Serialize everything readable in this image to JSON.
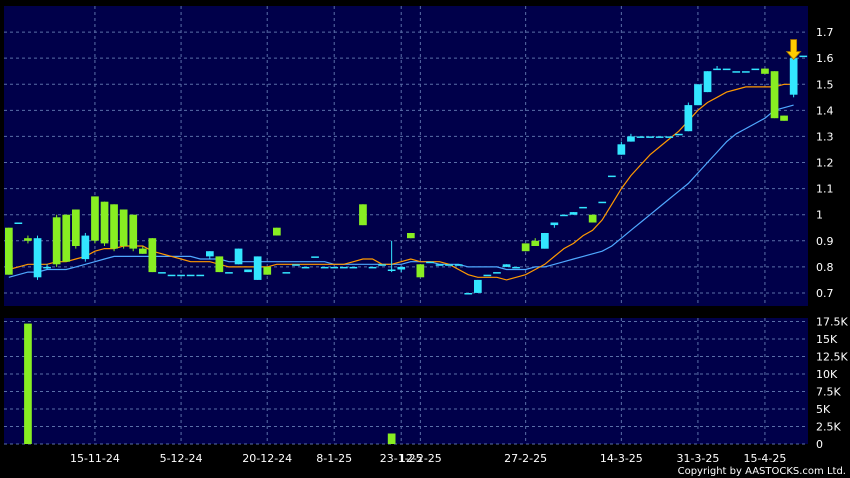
{
  "copyright": "Copyright by AASTOCKS.com Ltd.",
  "colors": {
    "background": "#000000",
    "panel": "#00004a",
    "grid": "#5a6fa8",
    "up_candle": "#33e6ff",
    "down_candle": "#88ee22",
    "ma_short": "#ff9900",
    "ma_long": "#4fa8ff",
    "volume": "#88ee22",
    "signal_arrow": "#ffcc00"
  },
  "chart_data": [
    {
      "type": "candlestick",
      "title": "",
      "ylim": [
        0.65,
        1.8
      ],
      "y_ticks": [
        "0.7",
        "0.8",
        "0.9",
        "1",
        "1.1",
        "1.2",
        "1.3",
        "1.4",
        "1.5",
        "1.6",
        "1.7"
      ],
      "x_tick_labels": [
        "15-11-24",
        "5-12-24",
        "20-12-24",
        "8-1-25",
        "23-1-25",
        "12-2-25",
        "27-2-25",
        "14-3-25",
        "31-3-25",
        "15-4-25"
      ],
      "x_tick_index": [
        9,
        18,
        27,
        34,
        41,
        43,
        54,
        64,
        72,
        79
      ],
      "candles": [
        [
          0.95,
          0.95,
          0.77,
          0.77
        ],
        [
          0.97,
          0.97,
          0.97,
          0.97
        ],
        [
          0.91,
          0.92,
          0.89,
          0.9
        ],
        [
          0.76,
          0.92,
          0.75,
          0.91
        ],
        [
          0.8,
          0.81,
          0.79,
          0.8
        ],
        [
          0.99,
          1.0,
          0.8,
          0.81
        ],
        [
          1.0,
          1.0,
          0.82,
          0.82
        ],
        [
          1.02,
          1.02,
          0.87,
          0.88
        ],
        [
          0.83,
          0.93,
          0.82,
          0.92
        ],
        [
          1.07,
          1.07,
          0.89,
          0.9
        ],
        [
          1.05,
          1.05,
          0.88,
          0.89
        ],
        [
          1.04,
          1.04,
          0.86,
          0.87
        ],
        [
          1.02,
          1.02,
          0.87,
          0.88
        ],
        [
          1.0,
          1.0,
          0.86,
          0.87
        ],
        [
          0.87,
          0.88,
          0.85,
          0.85
        ],
        [
          0.91,
          0.91,
          0.78,
          0.78
        ],
        [
          0.78,
          0.78,
          0.78,
          0.78
        ],
        [
          0.77,
          0.77,
          0.77,
          0.77
        ],
        [
          0.77,
          0.77,
          0.77,
          0.77
        ],
        [
          0.77,
          0.77,
          0.77,
          0.77
        ],
        [
          0.77,
          0.77,
          0.77,
          0.77
        ],
        [
          0.84,
          0.86,
          0.83,
          0.86
        ],
        [
          0.84,
          0.84,
          0.78,
          0.78
        ],
        [
          0.78,
          0.78,
          0.78,
          0.78
        ],
        [
          0.81,
          0.87,
          0.81,
          0.87
        ],
        [
          0.78,
          0.79,
          0.78,
          0.79
        ],
        [
          0.75,
          0.84,
          0.75,
          0.84
        ],
        [
          0.8,
          0.8,
          0.77,
          0.77
        ],
        [
          0.95,
          0.95,
          0.92,
          0.92
        ],
        [
          0.78,
          0.78,
          0.78,
          0.78
        ],
        [
          0.81,
          0.81,
          0.81,
          0.81
        ],
        [
          0.8,
          0.8,
          0.8,
          0.8
        ],
        [
          0.84,
          0.84,
          0.84,
          0.84
        ],
        [
          0.8,
          0.8,
          0.8,
          0.8
        ],
        [
          0.8,
          0.8,
          0.8,
          0.8
        ],
        [
          0.8,
          0.8,
          0.8,
          0.8
        ],
        [
          0.8,
          0.8,
          0.8,
          0.8
        ],
        [
          1.04,
          1.04,
          0.96,
          0.96
        ],
        [
          0.8,
          0.8,
          0.8,
          0.8
        ],
        [
          0.81,
          0.81,
          0.81,
          0.81
        ],
        [
          0.79,
          0.9,
          0.78,
          0.79
        ],
        [
          0.79,
          0.8,
          0.78,
          0.8
        ],
        [
          0.93,
          0.93,
          0.91,
          0.91
        ],
        [
          0.81,
          0.81,
          0.76,
          0.76
        ],
        [
          0.82,
          0.82,
          0.82,
          0.82
        ],
        [
          0.81,
          0.81,
          0.81,
          0.81
        ],
        [
          0.81,
          0.81,
          0.81,
          0.81
        ],
        [
          0.81,
          0.81,
          0.81,
          0.81
        ],
        [
          0.7,
          0.7,
          0.7,
          0.7
        ],
        [
          0.7,
          0.75,
          0.7,
          0.75
        ],
        [
          0.77,
          0.77,
          0.77,
          0.77
        ],
        [
          0.78,
          0.78,
          0.78,
          0.78
        ],
        [
          0.8,
          0.81,
          0.8,
          0.81
        ],
        [
          0.8,
          0.8,
          0.8,
          0.8
        ],
        [
          0.89,
          0.89,
          0.86,
          0.86
        ],
        [
          0.9,
          0.91,
          0.88,
          0.88
        ],
        [
          0.87,
          0.93,
          0.87,
          0.93
        ],
        [
          0.96,
          0.97,
          0.95,
          0.97
        ],
        [
          1.0,
          1.0,
          1.0,
          1.0
        ],
        [
          1.0,
          1.01,
          1.0,
          1.01
        ],
        [
          1.03,
          1.03,
          1.03,
          1.03
        ],
        [
          1.0,
          1.0,
          0.97,
          0.97
        ],
        [
          1.05,
          1.05,
          1.05,
          1.05
        ],
        [
          1.15,
          1.15,
          1.15,
          1.15
        ],
        [
          1.23,
          1.28,
          1.23,
          1.27
        ],
        [
          1.28,
          1.31,
          1.28,
          1.3
        ],
        [
          1.3,
          1.3,
          1.3,
          1.3
        ],
        [
          1.3,
          1.3,
          1.3,
          1.3
        ],
        [
          1.3,
          1.3,
          1.3,
          1.3
        ],
        [
          1.3,
          1.3,
          1.3,
          1.3
        ],
        [
          1.31,
          1.31,
          1.31,
          1.31
        ],
        [
          1.32,
          1.43,
          1.32,
          1.42
        ],
        [
          1.42,
          1.5,
          1.42,
          1.5
        ],
        [
          1.47,
          1.55,
          1.47,
          1.55
        ],
        [
          1.56,
          1.57,
          1.56,
          1.56
        ],
        [
          1.56,
          1.56,
          1.56,
          1.56
        ],
        [
          1.55,
          1.55,
          1.55,
          1.55
        ],
        [
          1.55,
          1.55,
          1.55,
          1.55
        ],
        [
          1.56,
          1.56,
          1.56,
          1.56
        ],
        [
          1.56,
          1.56,
          1.54,
          1.54
        ],
        [
          1.55,
          1.55,
          1.37,
          1.37
        ],
        [
          1.38,
          1.38,
          1.36,
          1.36
        ],
        [
          1.46,
          1.61,
          1.45,
          1.6
        ],
        [
          1.61,
          1.61,
          1.61,
          1.61
        ]
      ],
      "ma_short": [
        0.79,
        0.8,
        0.81,
        0.81,
        0.81,
        0.82,
        0.82,
        0.83,
        0.84,
        0.86,
        0.87,
        0.87,
        0.88,
        0.88,
        0.88,
        0.86,
        0.85,
        0.84,
        0.83,
        0.82,
        0.82,
        0.82,
        0.81,
        0.8,
        0.8,
        0.8,
        0.8,
        0.8,
        0.81,
        0.81,
        0.81,
        0.81,
        0.81,
        0.81,
        0.81,
        0.81,
        0.82,
        0.83,
        0.83,
        0.81,
        0.81,
        0.82,
        0.83,
        0.82,
        0.82,
        0.82,
        0.81,
        0.79,
        0.77,
        0.76,
        0.76,
        0.76,
        0.75,
        0.76,
        0.77,
        0.79,
        0.81,
        0.84,
        0.87,
        0.89,
        0.92,
        0.94,
        0.98,
        1.04,
        1.1,
        1.15,
        1.19,
        1.23,
        1.26,
        1.29,
        1.32,
        1.36,
        1.4,
        1.43,
        1.45,
        1.47,
        1.48,
        1.49,
        1.49,
        1.49,
        1.49,
        1.5,
        1.5
      ],
      "ma_long": [
        0.76,
        0.77,
        0.78,
        0.78,
        0.79,
        0.79,
        0.79,
        0.8,
        0.81,
        0.82,
        0.83,
        0.84,
        0.84,
        0.84,
        0.84,
        0.84,
        0.84,
        0.84,
        0.84,
        0.84,
        0.83,
        0.83,
        0.83,
        0.82,
        0.82,
        0.82,
        0.82,
        0.82,
        0.82,
        0.82,
        0.82,
        0.82,
        0.82,
        0.82,
        0.81,
        0.81,
        0.81,
        0.81,
        0.81,
        0.81,
        0.81,
        0.81,
        0.82,
        0.82,
        0.82,
        0.81,
        0.81,
        0.81,
        0.8,
        0.8,
        0.8,
        0.8,
        0.79,
        0.79,
        0.79,
        0.8,
        0.8,
        0.81,
        0.82,
        0.83,
        0.84,
        0.85,
        0.86,
        0.88,
        0.91,
        0.94,
        0.97,
        1.0,
        1.03,
        1.06,
        1.09,
        1.12,
        1.16,
        1.2,
        1.24,
        1.28,
        1.31,
        1.33,
        1.35,
        1.37,
        1.4,
        1.41,
        1.42
      ],
      "signal_arrow_index": 82
    },
    {
      "type": "bar",
      "ylim": [
        0,
        18000
      ],
      "y_ticks": [
        "0",
        "2.5K",
        "5K",
        "7.5K",
        "10K",
        "12.5K",
        "15K",
        "17.5K"
      ],
      "bars": [
        {
          "index": 2,
          "value": 17200
        },
        {
          "index": 40,
          "value": 1500
        }
      ]
    }
  ]
}
